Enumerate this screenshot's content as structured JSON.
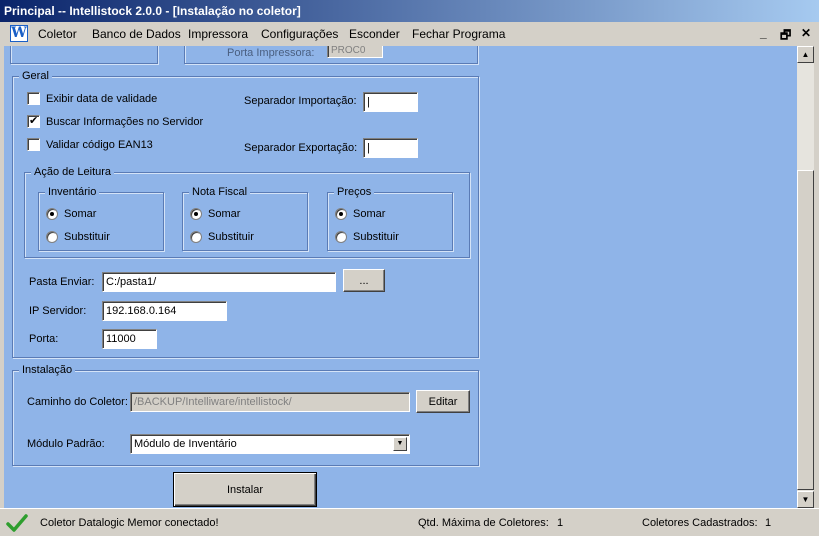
{
  "window": {
    "title": "Principal -- Intellistock 2.0.0 - [Instalação no coletor]"
  },
  "menu": {
    "icon": "W",
    "items": [
      {
        "label": "Coletor"
      },
      {
        "label": "Banco de Dados"
      },
      {
        "label": "Impressora"
      },
      {
        "label": "Configurações"
      },
      {
        "label": "Esconder"
      },
      {
        "label": "Fechar Programa"
      }
    ],
    "controls": {
      "minimize": "_",
      "restore": "🗗",
      "close": "✕"
    }
  },
  "partial_top": {
    "printer_port_label": "Porta Impressora:",
    "printer_port_value": "PROC0"
  },
  "geral": {
    "title": "Geral",
    "chk_validade": {
      "label": "Exibir data de validade",
      "checked": false
    },
    "chk_servidor": {
      "label": "Buscar Informações no Servidor",
      "checked": true
    },
    "chk_ean": {
      "label": "Validar código EAN13",
      "checked": false
    },
    "sep_import_label": "Separador Importação:",
    "sep_import_value": "|",
    "sep_export_label": "Separador Exportação:",
    "sep_export_value": "|",
    "acao": {
      "title": "Ação de Leitura",
      "inventario": {
        "title": "Inventário",
        "somar": "Somar",
        "substituir": "Substituir",
        "selected": "somar"
      },
      "nota": {
        "title": "Nota Fiscal",
        "somar": "Somar",
        "substituir": "Substituir",
        "selected": "somar"
      },
      "precos": {
        "title": "Preços",
        "somar": "Somar",
        "substituir": "Substituir",
        "selected": "somar"
      }
    },
    "pasta_label": "Pasta Enviar:",
    "pasta_value": "C:/pasta1/",
    "browse_label": "...",
    "ip_label": "IP Servidor:",
    "ip_value": "192.168.0.164",
    "porta_label": "Porta:",
    "porta_value": "11000"
  },
  "instalacao": {
    "title": "Instalação",
    "caminho_label": "Caminho do Coletor:",
    "caminho_value": "/BACKUP/Intelliware/intellistock/",
    "editar_label": "Editar",
    "modulo_label": "Módulo Padrão:",
    "modulo_value": "Módulo de Inventário"
  },
  "instalar_label": "Instalar",
  "status": {
    "message": "Coletor Datalogic Memor conectado!",
    "max_label": "Qtd. Máxima de Coletores:",
    "max_value": "1",
    "cad_label": "Coletores Cadastrados:",
    "cad_value": "1"
  },
  "colors": {
    "client_bg": "#8fb4e8",
    "title_start": "#0a246a",
    "title_end": "#a6caf0",
    "ok_green": "#2e9e2e"
  }
}
